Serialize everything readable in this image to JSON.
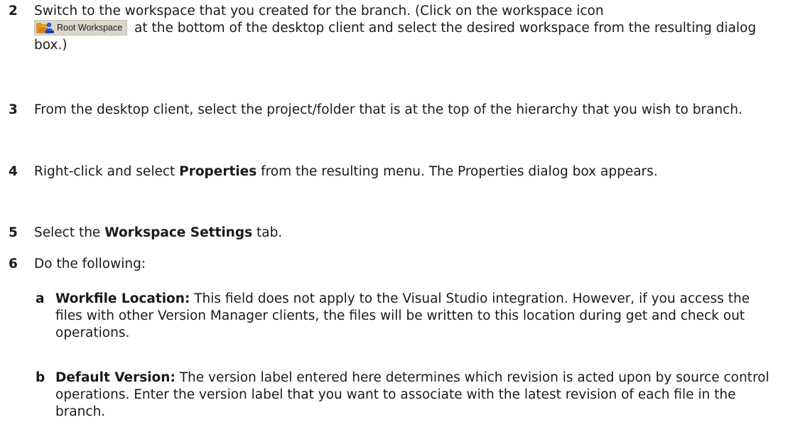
{
  "steps": [
    {
      "number": "2",
      "text_before_icon": "Switch to the workspace that you created for the branch. (Click on the workspace icon",
      "workspace_badge": {
        "icon": "workspace-icon",
        "label": "Root Workspace"
      },
      "text_after_icon": " at the bottom of the desktop client and select the desired workspace from the resulting dialog box.)"
    },
    {
      "number": "3",
      "text": "From the desktop client, select the project/folder that is at the top of the hierarchy that you wish to branch."
    },
    {
      "number": "4",
      "text_before_bold": "Right-click and select ",
      "bold": "Properties",
      "text_after_bold": " from the resulting menu. The Properties dialog box appears."
    },
    {
      "number": "5",
      "text_before_bold": "Select the ",
      "bold": "Workspace Settings",
      "text_after_bold": " tab."
    },
    {
      "number": "6",
      "text": "Do the following:"
    }
  ],
  "substeps": [
    {
      "letter": "a",
      "bold": "Workfile Location:",
      "text": " This field does not apply to the Visual Studio integration. However, if you access the files with other Version Manager clients, the files will be written to this location during get and check out operations."
    },
    {
      "letter": "b",
      "bold": "Default Version:",
      "text": " The version label entered here determines which revision is acted upon by source control operations. Enter the version label that you want to associate with the latest revision of each file in the branch."
    }
  ],
  "colors": {
    "text": "#1a1a1a",
    "badge_bg": "#d9d6cc",
    "folder_yellow": "#f2b21e",
    "folder_orange": "#e07b10",
    "person_blue": "#2a5bd7"
  }
}
